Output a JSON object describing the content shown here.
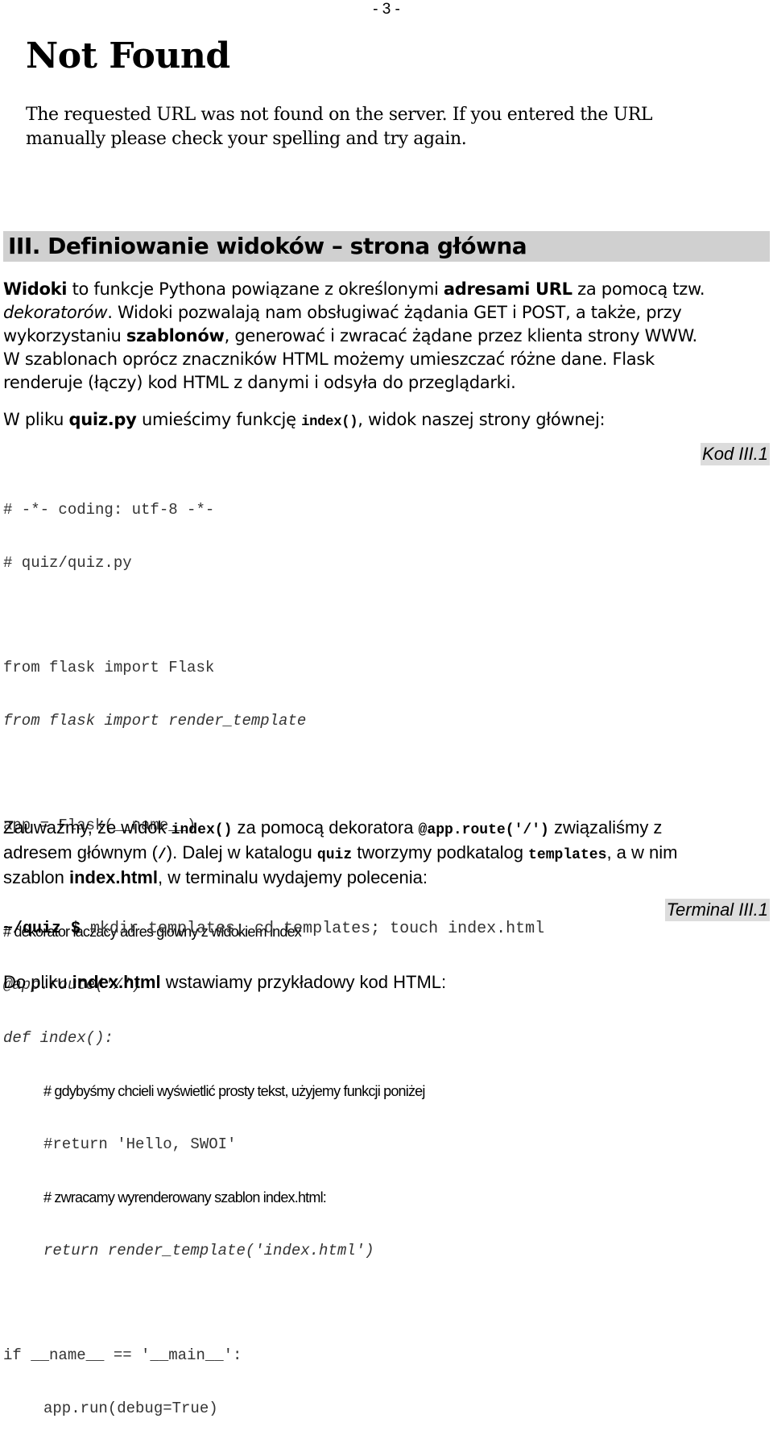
{
  "page_number": "- 3 -",
  "screenshot": {
    "title": "Not Found",
    "message_line1": "The requested URL was not found on the server. If you entered the URL",
    "message_line2": "manually please check your spelling and try again."
  },
  "section": {
    "heading": "III. Definiowanie widoków – strona główna"
  },
  "intro": {
    "l1_b1": "Widoki",
    "l1_t1": " to funkcje Pythona powiązane z określonymi ",
    "l1_b2": "adresami URL",
    "l1_t2": " za pomocą tzw.",
    "l2_i": "dekoratorów",
    "l2_t": ". Widoki pozwalają nam obsługiwać żądania GET i POST, a także, przy",
    "l3_t1": "wykorzystaniu ",
    "l3_b": "szablonów",
    "l3_t2": ", generować i zwracać żądane przez klienta strony WWW.",
    "l4": "W szablonach oprócz znaczników HTML możemy umieszczać różne dane. Flask",
    "l5": "renderuje (łączy) kod HTML z danymi i odsyła do przeglądarki."
  },
  "file_line": {
    "t1": "W pliku ",
    "b": "quiz.py",
    "t2": " umieścimy funkcję ",
    "code": "index()",
    "t3": ", widok naszej strony głównej:"
  },
  "code_block": {
    "label": "Kod III.1",
    "lines": [
      "# -*- coding: utf-8 -*-",
      "# quiz/quiz.py",
      "from flask import Flask",
      "from flask import render_template",
      "app = Flask(__name__)",
      "# dekorator laczacy adres glowny z widokiem index",
      "@app.route('/')",
      "def index():",
      "# gdybyśmy chcieli wyświetlić prosty tekst, użyjemy funkcji poniżej",
      "#return 'Hello, SWOI'",
      "# zwracamy wyrenderowany szablon index.html:",
      "return render_template('index.html')",
      "if __name__ == '__main__':",
      "app.run(debug=True)"
    ]
  },
  "explain": {
    "l1_t1": "Zauważmy, że widok ",
    "l1_c1": "index()",
    "l1_t2": " za pomocą dekoratora ",
    "l1_c2": "@app.route('/')",
    "l1_t3": " związaliśmy z",
    "l2_t1": "adresem głównym (",
    "l2_c1": "/",
    "l2_t2": "). Dalej w katalogu ",
    "l2_c2": "quiz",
    "l2_t3": " tworzymy podkatalog ",
    "l2_c3": "templates",
    "l2_t4": ", a w nim",
    "l3_t1": "szablon ",
    "l3_b": "index.html",
    "l3_t2": ", w terminalu wydajemy polecenia:"
  },
  "terminal": {
    "label": "Terminal III.1",
    "prompt": "~/quiz $",
    "command": " mkdir templates; cd templates; touch index.html"
  },
  "closing": {
    "t1": "Do pliku ",
    "b": "index.html",
    "t2": " wstawiamy przykładowy kod HTML:"
  }
}
